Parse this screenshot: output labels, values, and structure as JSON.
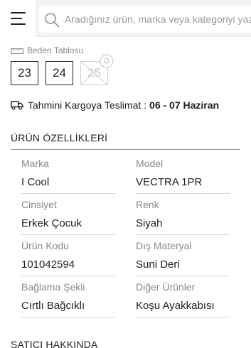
{
  "header": {
    "menu_icon": "hamburger-menu-icon",
    "search_icon": "search-icon",
    "search_placeholder": "Aradığınız ürün, marka veya kategoriyi yazınız"
  },
  "size_chart": {
    "icon": "ruler-icon",
    "label": "Beden Tablosu"
  },
  "sizes": [
    {
      "label": "23",
      "available": true
    },
    {
      "label": "24",
      "available": true
    },
    {
      "label": "25",
      "available": false,
      "notify_icon": "bell-icon"
    }
  ],
  "shipping": {
    "icon": "truck-icon",
    "label": "Tahmini Kargoya Teslimat :",
    "dates": "06 - 07 Haziran"
  },
  "features": {
    "title": "ÜRÜN ÖZELLİKLERİ",
    "items": [
      {
        "label": "Marka",
        "value": "I Cool"
      },
      {
        "label": "Model",
        "value": "VECTRA 1PR"
      },
      {
        "label": "Cinsiyet",
        "value": "Erkek Çocuk"
      },
      {
        "label": "Renk",
        "value": "Siyah"
      },
      {
        "label": "Ürün Kodu",
        "value": "101042594"
      },
      {
        "label": "Dış Materyal",
        "value": "Suni Deri"
      },
      {
        "label": "Bağlama Şekli",
        "value": "Cırtlı Bağcıklı"
      },
      {
        "label": "Diğer Ürünler",
        "value": "Koşu Ayakkabısı"
      }
    ]
  },
  "seller": {
    "title": "SATICI HAKKINDA"
  },
  "colors": {
    "text": "#222222",
    "muted": "#8a8a8a",
    "header_bg": "#f2f2f2",
    "disabled": "#c8c8c8"
  }
}
